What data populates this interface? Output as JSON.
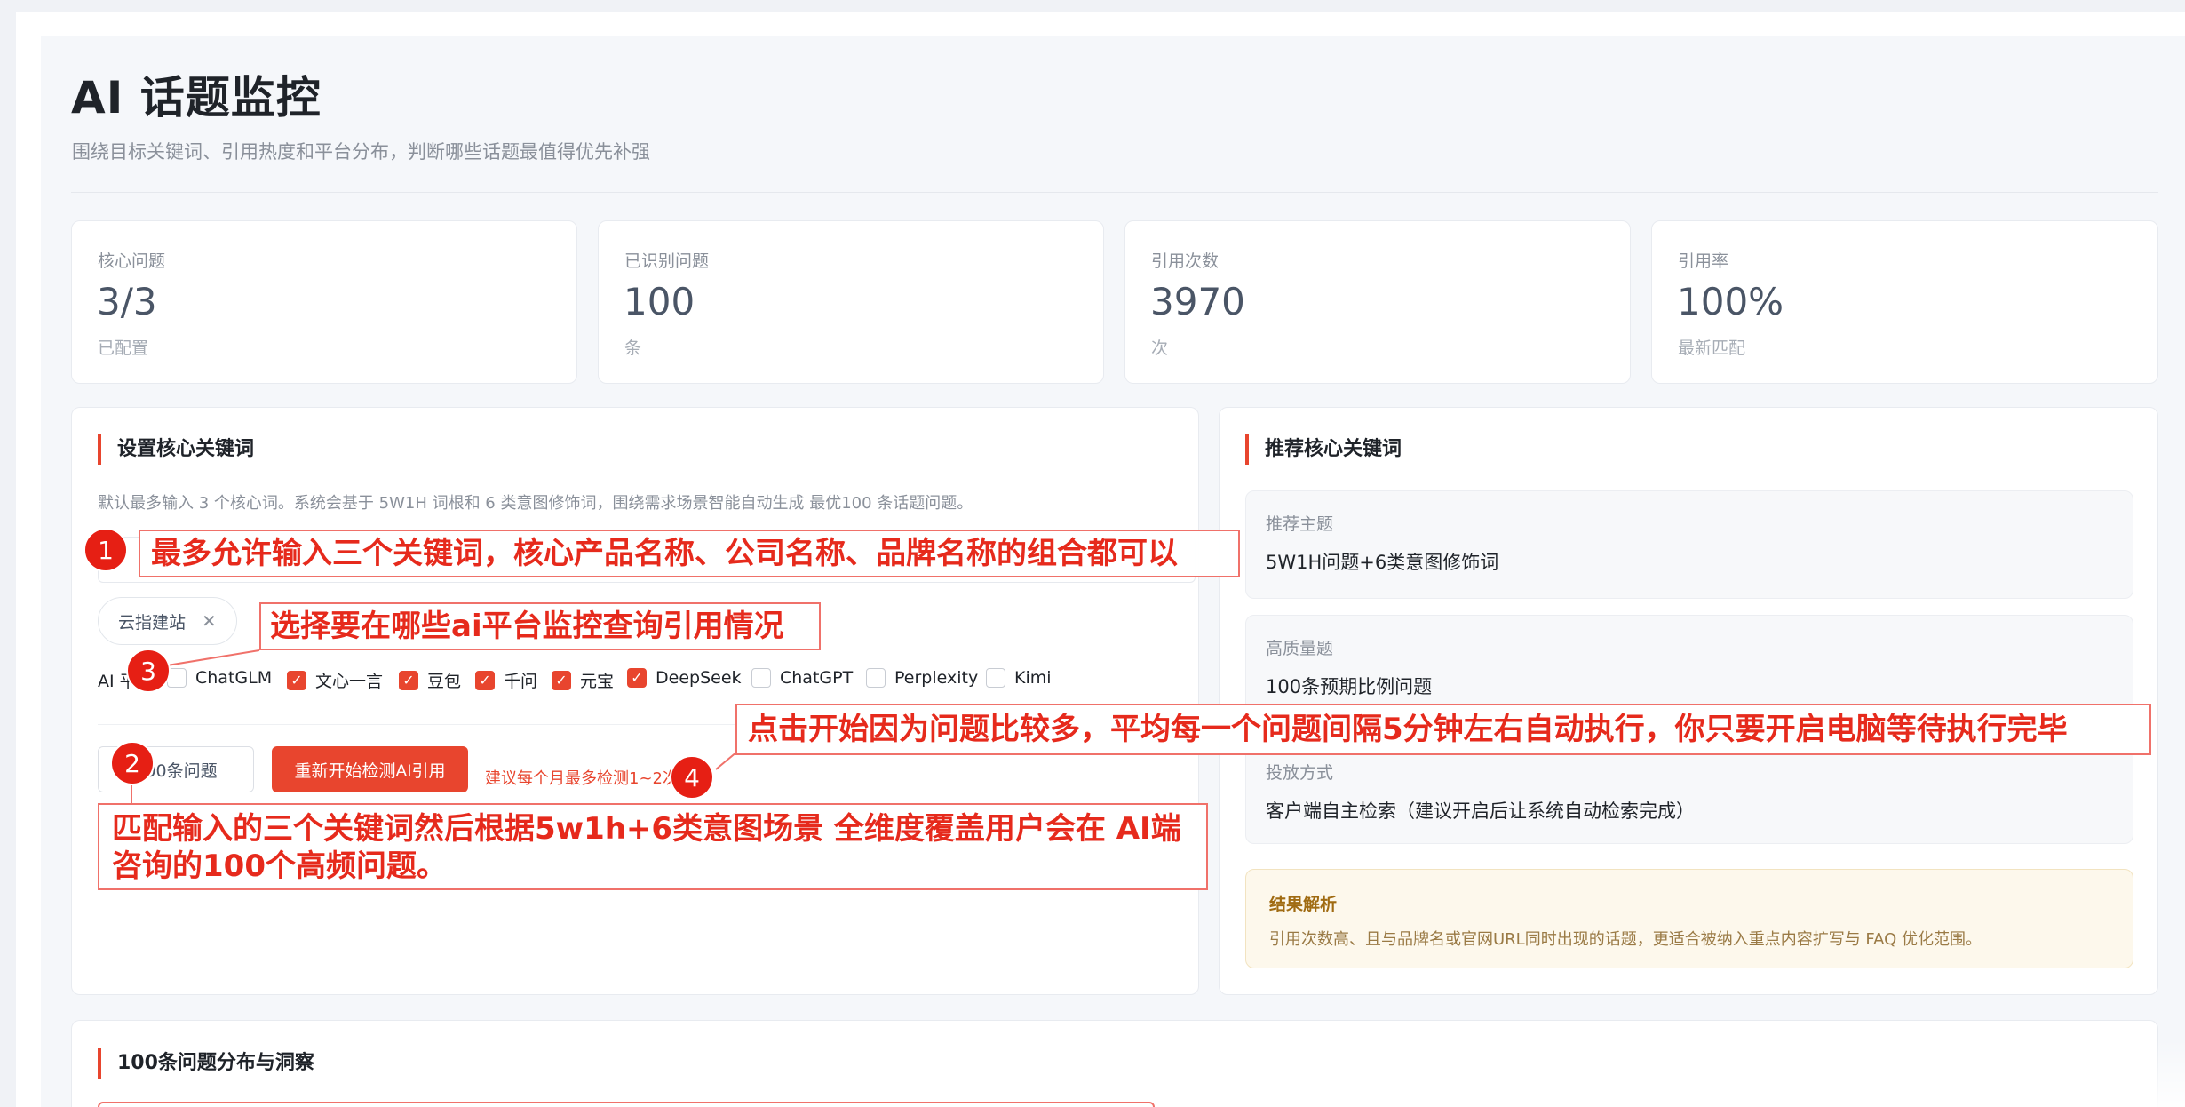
{
  "header": {
    "title": "AI 话题监控",
    "subtitle": "围绕目标关键词、引用热度和平台分布，判断哪些话题最值得优先补强"
  },
  "stats": [
    {
      "label": "核心问题",
      "value": "3/3",
      "unit": "已配置"
    },
    {
      "label": "已识别问题",
      "value": "100",
      "unit": "条"
    },
    {
      "label": "引用次数",
      "value": "3970",
      "unit": "次"
    },
    {
      "label": "引用率",
      "value": "100%",
      "unit": "最新匹配"
    }
  ],
  "keywords_panel": {
    "title": "设置核心关键词",
    "description": "默认最多输入 3 个核心词。系统会基于 5W1H 词根和 6 类意图修饰词，围绕需求场景智能自动生成 最优100 条话题问题。",
    "tag": "云指建站",
    "platform_label": "AI 平",
    "platforms": [
      {
        "name": "ChatGLM",
        "checked": false
      },
      {
        "name": "文心一言",
        "checked": true
      },
      {
        "name": "豆包",
        "checked": true
      },
      {
        "name": "千问",
        "checked": true
      },
      {
        "name": "元宝",
        "checked": true
      },
      {
        "name": "DeepSeek",
        "checked": true
      },
      {
        "name": "ChatGPT",
        "checked": false
      },
      {
        "name": "Perplexity",
        "checked": false
      },
      {
        "name": "Kimi",
        "checked": false
      }
    ],
    "questions_button": "100条问题",
    "start_button": "重新开始检测AI引用",
    "hint": "建议每个月最多检测1~2次"
  },
  "recommend_panel": {
    "title": "推荐核心关键词",
    "items": [
      {
        "label": "推荐主题",
        "value": "5W1H问题+6类意图修饰词"
      },
      {
        "label": "高质量题",
        "value": "100条预期比例问题"
      },
      {
        "label": "投放方式",
        "value": "客户端自主检索（建议开启后让系统自动检索完成）"
      }
    ],
    "result_title": "结果解析",
    "result_text": "引用次数高、且与品牌名或官网URL同时出现的话题，更适合被纳入重点内容扩写与 FAQ 优化范围。"
  },
  "distribution_panel": {
    "title": "100条问题分布与洞察"
  },
  "annotations": [
    {
      "num": "1",
      "text": "最多允许输入三个关键词，核心产品名称、公司名称、品牌名称的组合都可以"
    },
    {
      "num": "3",
      "text": "选择要在哪些ai平台监控查询引用情况"
    },
    {
      "num": "4",
      "text": "点击开始因为问题比较多，平均每一个问题间隔5分钟左右自动执行，你只要开启电脑等待执行完毕"
    },
    {
      "num": "2",
      "line1": "匹配输入的三个关键词然后根据5w1h+6类意图场景 全维度覆盖用户会在 AI端",
      "line2": "咨询的100个高频问题。"
    }
  ],
  "colors": {
    "accent": "#e8452e",
    "annotation": "#e62a1c"
  }
}
